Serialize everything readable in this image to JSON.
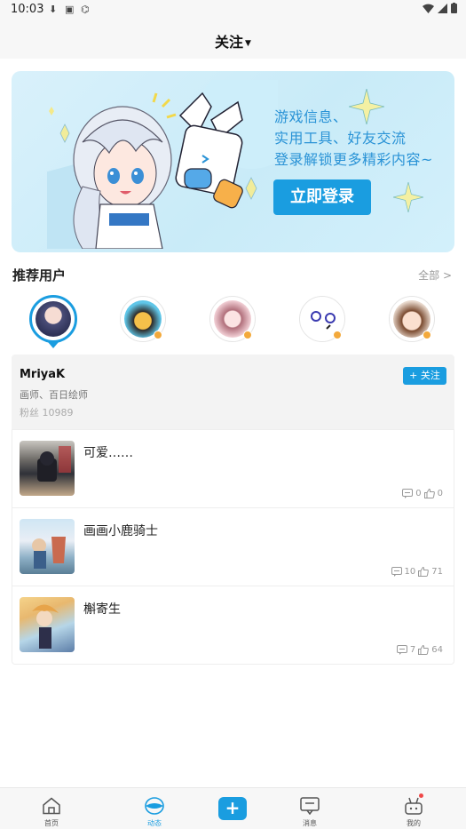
{
  "status_bar": {
    "time": "10:03"
  },
  "header": {
    "title": "关注"
  },
  "banner": {
    "lines": [
      "游戏信息、",
      "实用工具、好友交流",
      "登录解锁更多精彩内容~"
    ],
    "login_button": "立即登录"
  },
  "recommend": {
    "title": "推荐用户",
    "all_label": "全部 >"
  },
  "user_card": {
    "name": "MriyaK",
    "description": "画师、百日绘师",
    "fans": "粉丝 10989",
    "follow_label": "+ 关注"
  },
  "posts": [
    {
      "title": "可爱……",
      "comments": "0",
      "likes": "0"
    },
    {
      "title": "画画小鹿骑士",
      "comments": "10",
      "likes": "71"
    },
    {
      "title": "槲寄生",
      "comments": "7",
      "likes": "64"
    }
  ],
  "bottom_nav": {
    "home": "首页",
    "feed": "动态",
    "add": "+",
    "messages": "消息",
    "mine": "我的"
  },
  "colors": {
    "accent": "#1a9de0",
    "badge": "#f3a93b"
  }
}
